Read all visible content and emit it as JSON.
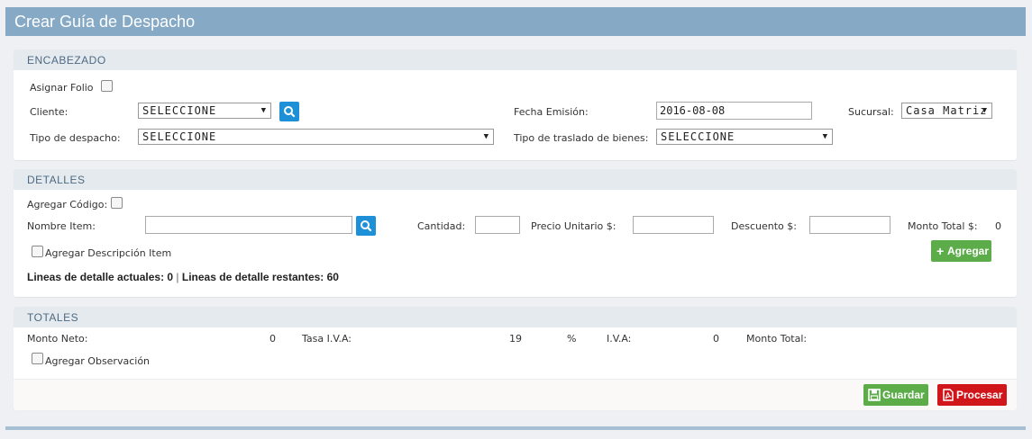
{
  "page": {
    "title": "Crear Guía de Despacho"
  },
  "encabezado": {
    "heading": "ENCABEZADO",
    "asignar_folio": "Asignar Folio",
    "cliente_label": "Cliente:",
    "cliente_value": "SELECCIONE",
    "fecha_label": "Fecha Emisión:",
    "fecha_value": "2016-08-08",
    "sucursal_label": "Sucursal:",
    "sucursal_value": "Casa Matriz",
    "tipo_despacho_label": "Tipo de despacho:",
    "tipo_despacho_value": "SELECCIONE",
    "tipo_traslado_label": "Tipo de traslado de bienes:",
    "tipo_traslado_value": "SELECCIONE"
  },
  "detalles": {
    "heading": "DETALLES",
    "agregar_codigo": "Agregar Código:",
    "nombre_item_label": "Nombre Item:",
    "cantidad_label": "Cantidad:",
    "precio_label": "Precio Unitario $:",
    "descuento_label": "Descuento $:",
    "monto_total_label": "Monto Total $:",
    "monto_total_value": "0",
    "agregar_descripcion": "Agregar Descripción Item",
    "agregar_button": "Agregar",
    "lineas_actuales": "Lineas de detalle actuales: 0",
    "separator": "|",
    "lineas_restantes": "Lineas de detalle restantes: 60"
  },
  "totales": {
    "heading": "TOTALES",
    "monto_neto_label": "Monto Neto:",
    "monto_neto_value": "0",
    "tasa_iva_label": "Tasa I.V.A:",
    "tasa_iva_value": "19",
    "percent": "%",
    "iva_label": "I.V.A:",
    "iva_value": "0",
    "monto_total_label": "Monto Total:",
    "agregar_observacion": "Agregar Observación",
    "guardar_button": "Guardar",
    "procesar_button": "Procesar"
  },
  "colors": {
    "header": "#86a9c6",
    "search": "#1e90d8",
    "success": "#5cac4a",
    "danger": "#d0161b"
  }
}
